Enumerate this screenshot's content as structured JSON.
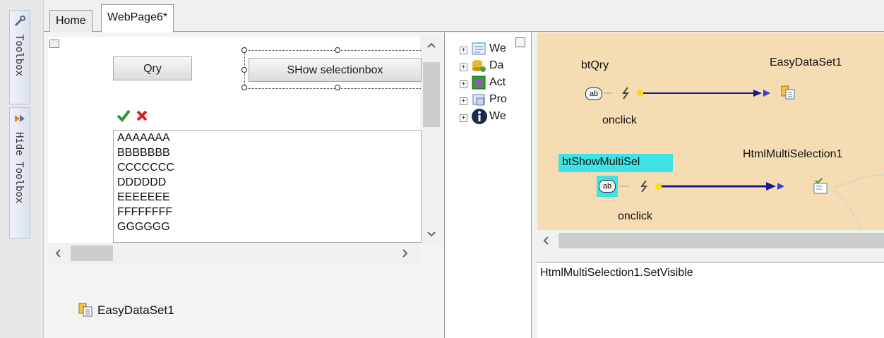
{
  "toolbox": {
    "toolbox_label": "Toolbox",
    "hide_label": "Hide Toolbox"
  },
  "tabs": [
    {
      "label": "Home"
    },
    {
      "label": "WebPage6*"
    }
  ],
  "design": {
    "qry_button": "Qry",
    "show_button": "SHow selectionbox",
    "list_items": [
      "AAAAAAA",
      "BBBBBBB",
      "CCCCCCC",
      "DDDDDD",
      "EEEEEEE",
      "FFFFFFFF",
      "GGGGGG"
    ],
    "dataset_label": "EasyDataSet1"
  },
  "tree": {
    "items": [
      {
        "label": "We",
        "icon": "page-icon"
      },
      {
        "label": "Da",
        "icon": "database-icon"
      },
      {
        "label": "Act",
        "icon": "action-icon"
      },
      {
        "label": "Pro",
        "icon": "property-icon"
      },
      {
        "label": "We",
        "icon": "info-icon"
      }
    ]
  },
  "event_map": {
    "source1": "btQry",
    "event1": "onclick",
    "target1": "EasyDataSet1",
    "source2": "btShowMultiSel",
    "event2": "onclick",
    "target2": "HtmlMultiSelection1",
    "colors": {
      "panel": "#f5dcb3",
      "highlight": "#3fe3e6",
      "arrow": "#1a1a8c"
    }
  },
  "code": {
    "text": "HtmlMultiSelection1.SetVisible"
  }
}
